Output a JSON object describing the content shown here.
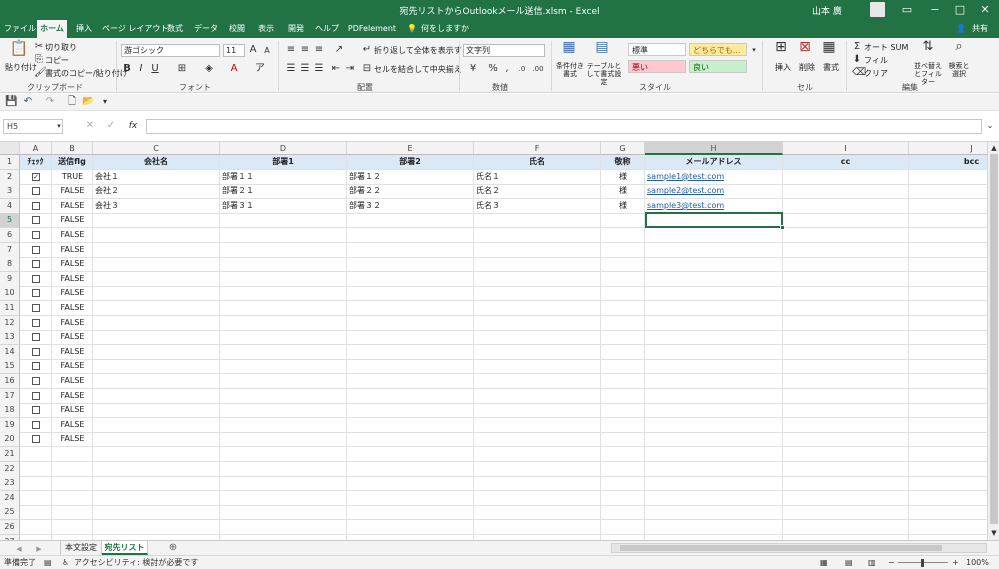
{
  "app": {
    "title": "宛先リストからOutlookメール送信.xlsm  -  Excel",
    "user": "山本 廣",
    "window_buttons": [
      "−",
      "□",
      "✕"
    ],
    "ribbon_display_icon": "ribbon-display-icon"
  },
  "tabs": [
    "ファイル",
    "ホーム",
    "挿入",
    "ページ レイアウト",
    "数式",
    "データ",
    "校閲",
    "表示",
    "開発",
    "ヘルプ",
    "PDFelement"
  ],
  "active_tab": "ホーム",
  "tell_me": "何をしますか",
  "share": "共有",
  "ribbon": {
    "clipboard": {
      "paste": "貼り付け",
      "cut": "切り取り",
      "copy": "コピー",
      "format_painter": "書式のコピー/貼り付け",
      "label": "クリップボード"
    },
    "font": {
      "name": "游ゴシック",
      "size": "11",
      "bold": "B",
      "italic": "I",
      "underline": "U",
      "label": "フォント"
    },
    "alignment": {
      "wrap": "折り返して全体を表示する",
      "merge": "セルを結合して中央揃え",
      "label": "配置"
    },
    "number": {
      "format": "文字列",
      "label": "数値"
    },
    "styles": {
      "conditional": "条件付き書式",
      "table": "テーブルとして書式設定",
      "cells": [
        "標準",
        "どちらでも...",
        "悪い",
        "良い"
      ],
      "label": "スタイル"
    },
    "cells": {
      "insert": "挿入",
      "delete": "削除",
      "format": "書式",
      "label": "セル"
    },
    "editing": {
      "autosum": "オート SUM",
      "fill": "フィル",
      "clear": "クリア",
      "sort": "並べ替えとフィルター",
      "find": "検索と選択",
      "label": "編集"
    }
  },
  "formula_bar": {
    "name_box": "H5",
    "fx": "fx",
    "value": ""
  },
  "columns": [
    "A",
    "B",
    "C",
    "D",
    "E",
    "F",
    "G",
    "H",
    "I",
    "J"
  ],
  "selected_column": "H",
  "selected_row": "5",
  "header_row": [
    "ﾁｪｯｸ",
    "送信flg",
    "会社名",
    "部署1",
    "部署2",
    "氏名",
    "敬称",
    "メールアドレス",
    "cc",
    "bcc"
  ],
  "data_rows": [
    {
      "checked": true,
      "flag": "TRUE",
      "company": "会社１",
      "dept1": "部署１１",
      "dept2": "部署１２",
      "name": "氏名１",
      "title": "様",
      "email": "sample1@test.com"
    },
    {
      "checked": false,
      "flag": "FALSE",
      "company": "会社２",
      "dept1": "部署２１",
      "dept2": "部署２２",
      "name": "氏名２",
      "title": "様",
      "email": "sample2@test.com"
    },
    {
      "checked": false,
      "flag": "FALSE",
      "company": "会社３",
      "dept1": "部署３１",
      "dept2": "部署３２",
      "name": "氏名３",
      "title": "様",
      "email": "sample3@test.com"
    }
  ],
  "empty_flag_rows": 16,
  "empty_flag_value": "FALSE",
  "total_rows": 27,
  "sheets": [
    "本文設定",
    "宛先リスト"
  ],
  "active_sheet": "宛先リスト",
  "status": {
    "ready": "準備完了",
    "accessibility": "アクセシビリティ: 検討が必要です",
    "zoom": "100%"
  }
}
